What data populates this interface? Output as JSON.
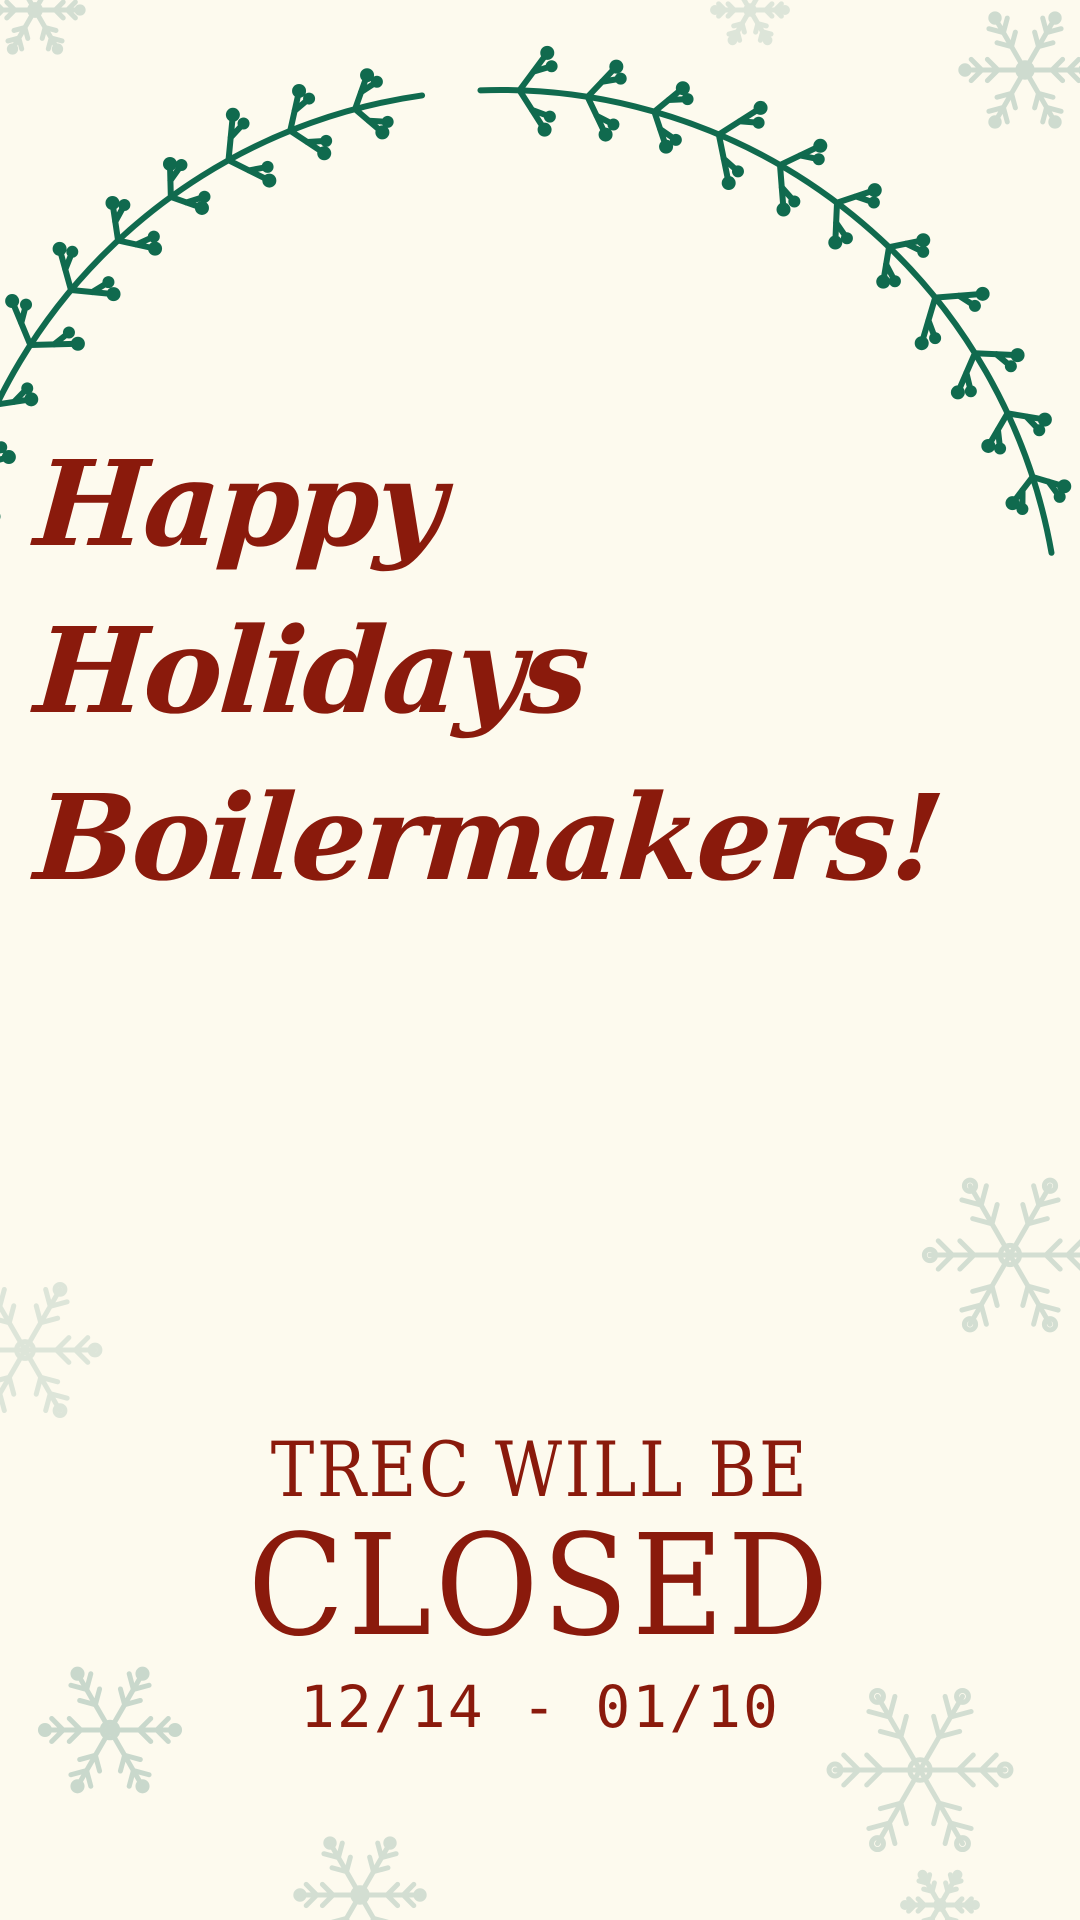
{
  "greeting": {
    "line1": "Happy",
    "line2": "Holidays",
    "line3": "Boilermakers!"
  },
  "notice": {
    "line1": "TREC WILL BE",
    "line2": "CLOSED",
    "dates": "12/14 - 01/10"
  },
  "colors": {
    "background": "#fdfaee",
    "text": "#8a1a0c",
    "wreath": "#106a4e",
    "snowflake": "#c9d8cc"
  },
  "icons": [
    "wreath-icon",
    "snowflake-icon"
  ]
}
